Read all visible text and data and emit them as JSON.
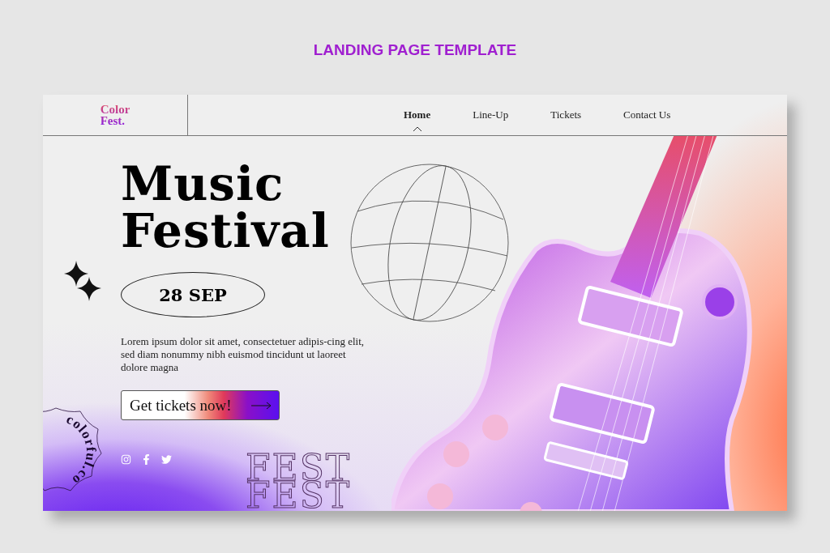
{
  "page_title": "LANDING PAGE TEMPLATE",
  "logo": {
    "line_1": "Color",
    "line_2": "Fest."
  },
  "nav": [
    {
      "label": "Home",
      "selected": true
    },
    {
      "label": "Line-Up",
      "selected": false
    },
    {
      "label": "Tickets",
      "selected": false
    },
    {
      "label": "Contact Us",
      "selected": false
    }
  ],
  "hero": {
    "title_lines": [
      "Music",
      "Festival"
    ],
    "date": "28 SEP",
    "description": "Lorem ipsum dolor sit amet, consectetuer adipis-cing elit, sed diam nonummy nibh euismod tincidunt ut laoreet dolore magna",
    "cta": "Get tickets now!"
  },
  "badge": "colorful.co",
  "social": [
    {
      "kind": "instagram"
    },
    {
      "kind": "facebook"
    },
    {
      "kind": "twitter"
    }
  ],
  "outline_words": [
    "FEST",
    "FEST"
  ]
}
